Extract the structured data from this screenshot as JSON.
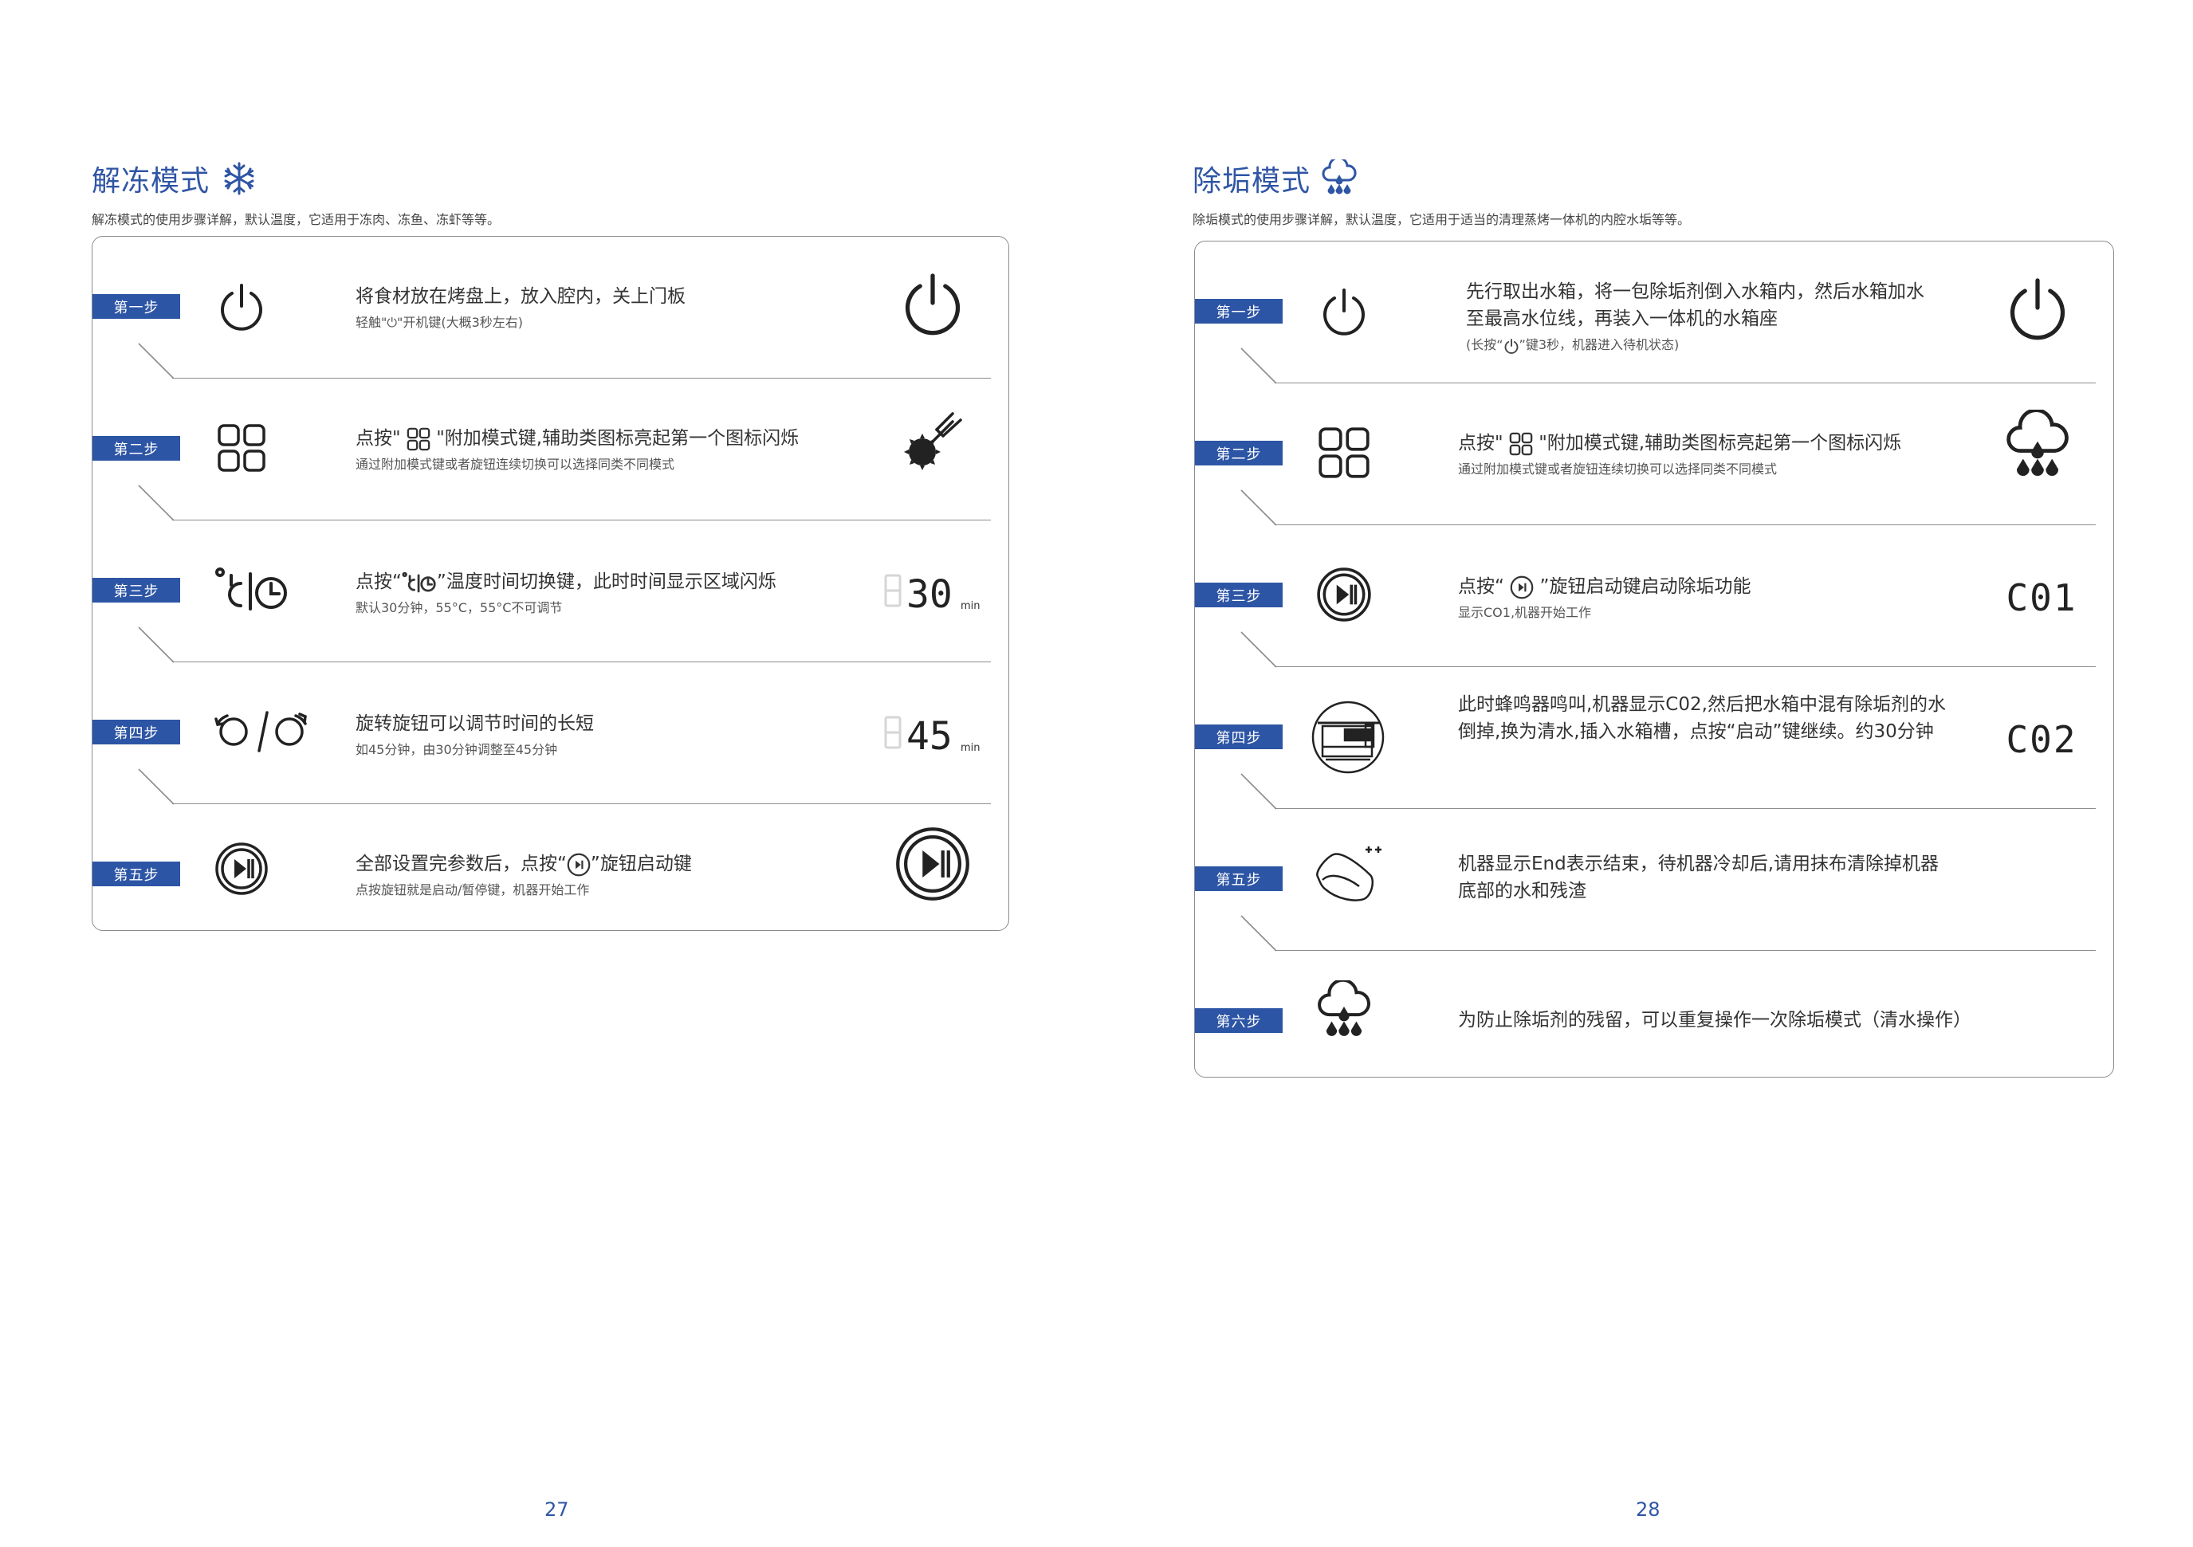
{
  "left": {
    "title": "解冻模式",
    "subtitle": "解冻模式的使用步骤详解，默认温度，它适用于冻肉、冻鱼、冻虾等等。",
    "page_number": "27",
    "steps": [
      {
        "tag": "第一步",
        "text": "将食材放在烤盘上，放入腔内，关上门板",
        "note": "轻触\"⏻\"开机键(大概3秒左右)",
        "left_icon": "power-icon",
        "right_icon": "power-icon"
      },
      {
        "tag": "第二步",
        "text_pre": "点按\" ",
        "text_post": " \"附加模式键,辅助类图标亮起第一个图标闪烁",
        "note": "通过附加模式键或者旋钮连续切换可以选择同类不同模式",
        "left_icon": "mode-grid-icon",
        "right_icon": "thaw-mode-icon"
      },
      {
        "tag": "第三步",
        "text_pre": "点按“",
        "text_post": "”温度时间切换键，此时时间显示区域闪烁",
        "note": "默认30分钟，55°C，55°C不可调节",
        "left_icon": "temp-time-switch-icon",
        "right_display": "30",
        "right_unit": "min"
      },
      {
        "tag": "第四步",
        "text": "旋转旋钮可以调节时间的长短",
        "note": "如45分钟，由30分钟调整至45分钟",
        "left_icon": "rotate-knob-icon",
        "right_display": "45",
        "right_unit": "min"
      },
      {
        "tag": "第五步",
        "text_pre": "全部设置完参数后，点按“",
        "text_post": "”旋钮启动键",
        "note": "点按旋钮就是启动/暂停键，机器开始工作",
        "left_icon": "play-pause-icon",
        "right_icon": "play-pause-icon"
      }
    ]
  },
  "right": {
    "title": "除垢模式",
    "subtitle": "除垢模式的使用步骤详解，默认温度，它适用于适当的清理蒸烤一体机的内腔水垢等等。",
    "page_number": "28",
    "steps": [
      {
        "tag": "第一步",
        "text": "先行取出水箱，将一包除垢剂倒入水箱内，然后水箱加水至最高水位线，再装入一体机的水箱座",
        "note_pre": "(长按“",
        "note_post": "”键3秒，机器进入待机状态)",
        "left_icon": "power-icon",
        "right_icon": "power-icon"
      },
      {
        "tag": "第二步",
        "text_pre": "点按\" ",
        "text_post": " \"附加模式键,辅助类图标亮起第一个图标闪烁",
        "note": "通过附加模式键或者旋钮连续切换可以选择同类不同模式",
        "left_icon": "mode-grid-icon",
        "right_icon": "descale-icon"
      },
      {
        "tag": "第三步",
        "text_pre": "点按“ ",
        "text_post": " ”旋钮启动键启动除垢功能",
        "note": "显示CO1,机器开始工作",
        "left_icon": "play-pause-icon",
        "right_display": "C01"
      },
      {
        "tag": "第四步",
        "text": "此时蜂鸣器鸣叫,机器显示C02,然后把水箱中混有除垢剂的水倒掉,换为清水,插入水箱槽，点按“启动”键继续。约30分钟",
        "left_icon": "water-tank-icon",
        "right_display": "C02"
      },
      {
        "tag": "第五步",
        "text": "机器显示End表示结束，待机器冷却后,请用抹布清除掉机器底部的水和残渣",
        "left_icon": "cloth-icon"
      },
      {
        "tag": "第六步",
        "text": "为防止除垢剂的残留，可以重复操作一次除垢模式（清水操作）",
        "left_icon": "descale-icon"
      }
    ]
  }
}
